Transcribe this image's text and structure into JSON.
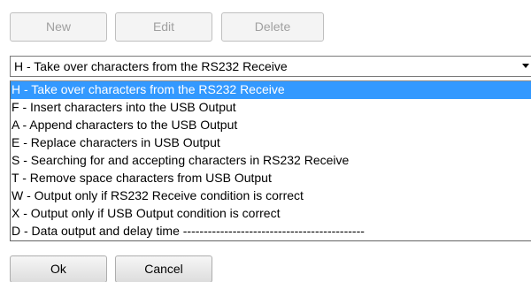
{
  "toolbar": {
    "new_label": "New",
    "edit_label": "Edit",
    "delete_label": "Delete"
  },
  "combo": {
    "selected": "H - Take over characters from the RS232 Receive"
  },
  "dropdown": {
    "highlighted_index": 0,
    "options": [
      "H - Take over characters from the RS232 Receive",
      "F - Insert characters into the USB Output",
      "A - Append characters to the USB Output",
      "E - Replace characters in USB Output",
      "S - Searching for and accepting characters in RS232 Receive",
      "T - Remove space characters from USB Output",
      "W - Output only if RS232 Receive condition is correct",
      "X - Output only if USB Output condition is correct",
      "D - Data output and delay time --------------------------------------------"
    ]
  },
  "footer": {
    "ok_label": "Ok",
    "cancel_label": "Cancel"
  }
}
